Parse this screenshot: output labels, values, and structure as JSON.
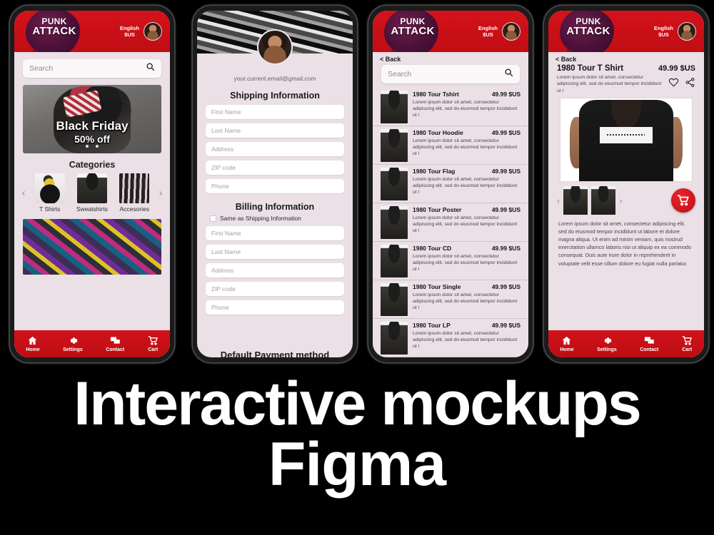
{
  "caption": {
    "line1": "Interactive mockups",
    "line2": "Figma"
  },
  "brand": {
    "logo_line1": "PUNK",
    "logo_line2": "ATTACK",
    "accent_red": "#c00d14",
    "splat_purple": "#4a1038",
    "screen_bg": "#eae0e6"
  },
  "header": {
    "language": "English",
    "currency": "$US",
    "avatar_icon": "user-avatar"
  },
  "tabbar": {
    "items": [
      {
        "label": "Home",
        "icon": "home-icon"
      },
      {
        "label": "Settings",
        "icon": "gear-icon"
      },
      {
        "label": "Contact",
        "icon": "chat-icon"
      },
      {
        "label": "Cart",
        "icon": "cart-icon"
      }
    ]
  },
  "phone1": {
    "search": {
      "placeholder": "Search",
      "icon": "search-icon"
    },
    "promo": {
      "line1": "Black Friday",
      "line2": "50% off"
    },
    "categories_title": "Categories",
    "categories": [
      {
        "label": "T Shirts",
        "icon": "duck-thumb"
      },
      {
        "label": "Sweatshirts",
        "icon": "hoodie-thumb"
      },
      {
        "label": "Accesories",
        "icon": "cuff-thumb"
      }
    ],
    "prev_arrow": "‹",
    "next_arrow": "›"
  },
  "phone2": {
    "email": "your.current.email@gmail.com",
    "shipping_title": "Shipping Information",
    "shipping_fields": [
      "First Name",
      "Last Name",
      "Address",
      "ZIP code",
      "Phone"
    ],
    "billing_title": "Billing Information",
    "same_as_shipping": "Same as Shipping Information",
    "billing_fields": [
      "First Name",
      "Last Name",
      "Address",
      "ZIP code",
      "Phone"
    ],
    "next_section_title": "Default Payment method"
  },
  "phone3": {
    "back": "< Back",
    "search": {
      "placeholder": "Search",
      "icon": "search-icon"
    },
    "product_desc": "Lorem ipsum dolor sit amet, consectetur adipiscing elit, sed do eiusmod tempor incididunt ut l",
    "products": [
      {
        "name": "1980 Tour Tshirt",
        "price": "49.99 $US"
      },
      {
        "name": "1980 Tour Hoodie",
        "price": "49.99 $US"
      },
      {
        "name": "1980 Tour Flag",
        "price": "49.99 $US"
      },
      {
        "name": "1980 Tour Poster",
        "price": "49.99 $US"
      },
      {
        "name": "1980 Tour CD",
        "price": "49.99 $US"
      },
      {
        "name": "1980 Tour Single",
        "price": "49.99 $US"
      },
      {
        "name": "1980 Tour LP",
        "price": "49.99 $US"
      }
    ]
  },
  "phone4": {
    "back": "< Back",
    "title": "1980 Tour T Shirt",
    "price": "49.99 $US",
    "short_desc": "Lorem ipsum dolor sit amet, consectetur adipiscing elit, sed do eiusmod tempor incididunt ut l",
    "favorite_icon": "heart-icon",
    "share_icon": "share-icon",
    "prev_arrow": "‹",
    "next_arrow": "›",
    "cart_icon": "cart-icon",
    "long_desc": "Lorem ipsum dolor sit amet, consectetur adipiscing elit, sed do eiusmod tempor incididunt ut labore et dolore magna aliqua. Ut enim ad minim veniam, quis nostrud exercitation ullamco laboris nisi ut aliquip ex ea commodo consequat. Duis aute irure dolor in reprehenderit in voluptate velit esse cillum dolore eu fugiat nulla pariatur."
  }
}
